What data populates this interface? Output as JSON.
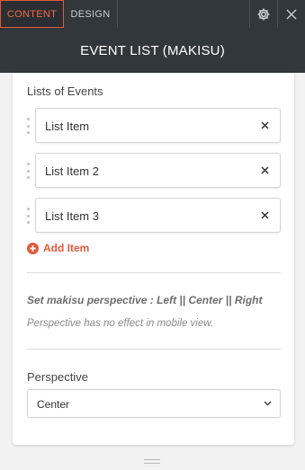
{
  "tabs": [
    {
      "label": "CONTENT",
      "active": true
    },
    {
      "label": "DESIGN",
      "active": false
    }
  ],
  "toolbar": {
    "settings_icon": "gear-icon",
    "close_icon": "close-icon"
  },
  "header": {
    "title": "EVENT LIST (MAKISU)"
  },
  "list_section": {
    "label": "Lists of Events",
    "items": [
      {
        "label": "List Item"
      },
      {
        "label": "List Item 2"
      },
      {
        "label": "List Item 3"
      }
    ],
    "add_label": "Add Item"
  },
  "perspective_info": {
    "heading": "Set makisu perspective : Left || Center || Right",
    "note": "Perspective has no effect in mobile view."
  },
  "perspective_field": {
    "label": "Perspective",
    "value": "Center"
  },
  "colors": {
    "accent": "#e2593a",
    "header_bg": "#32373c",
    "page_bg": "#f2f2f2"
  }
}
